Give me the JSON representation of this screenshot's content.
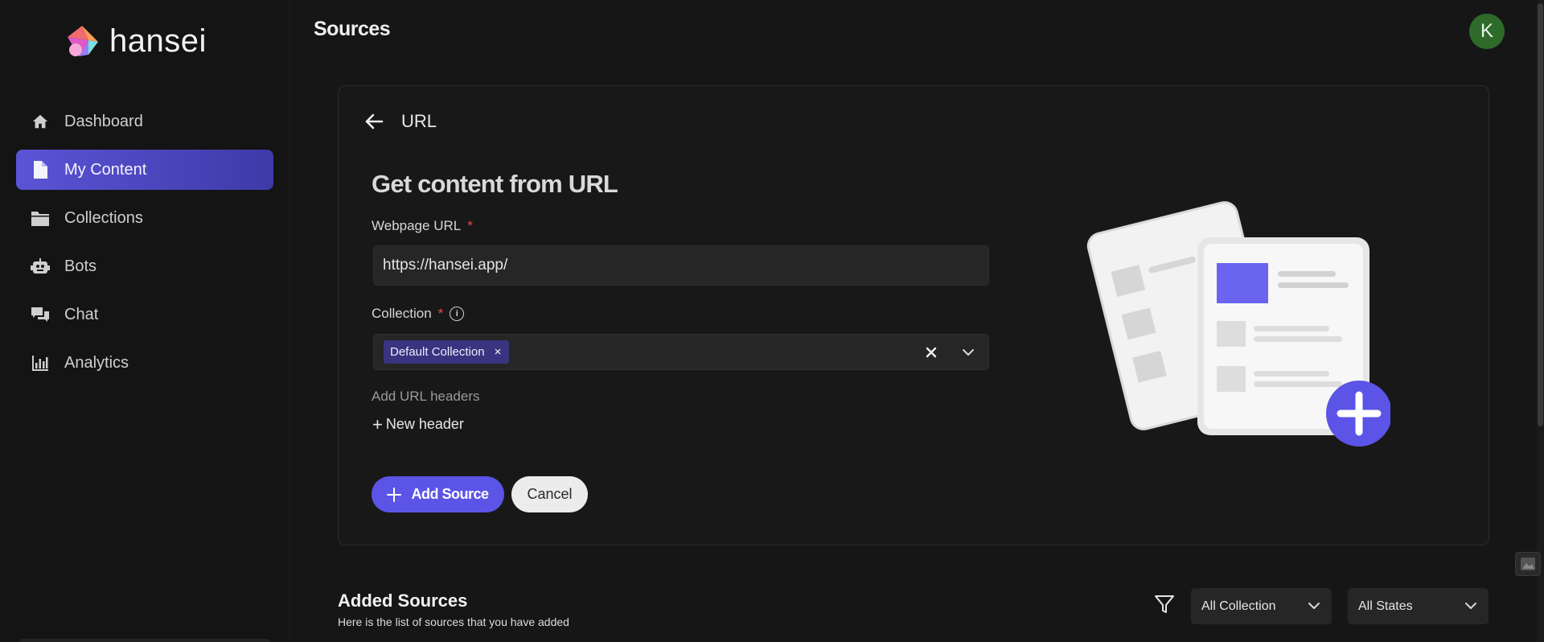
{
  "brand": {
    "name_main": "hans",
    "name_dot_letter": "ei"
  },
  "sidebar": {
    "items": [
      {
        "label": "Dashboard",
        "icon": "home-icon",
        "active": false
      },
      {
        "label": "My Content",
        "icon": "file-icon",
        "active": true
      },
      {
        "label": "Collections",
        "icon": "folder-icon",
        "active": false
      },
      {
        "label": "Bots",
        "icon": "robot-icon",
        "active": false
      },
      {
        "label": "Chat",
        "icon": "chat-icon",
        "active": false
      },
      {
        "label": "Analytics",
        "icon": "bar-chart-icon",
        "active": false
      }
    ]
  },
  "header": {
    "title": "Sources",
    "avatar_initial": "K"
  },
  "form": {
    "back_label": "URL",
    "title": "Get content from URL",
    "url_label": "Webpage URL",
    "required_mark": "*",
    "url_value": "https://hansei.app/",
    "collection_label": "Collection",
    "collection_chip": "Default Collection",
    "chip_remove": "×",
    "headers_label": "Add URL headers",
    "new_header_plus": "+",
    "new_header_label": "New header",
    "add_button": "Add Source",
    "cancel_button": "Cancel"
  },
  "added_sources": {
    "title": "Added Sources",
    "subtitle": "Here is the list of sources that you have added",
    "filter_collection": "All Collection",
    "filter_state": "All States"
  },
  "colors": {
    "accent": "#5b54e6",
    "active_nav": "#5b54d6",
    "avatar": "#2e6b2b",
    "required": "#ef4a4a"
  }
}
